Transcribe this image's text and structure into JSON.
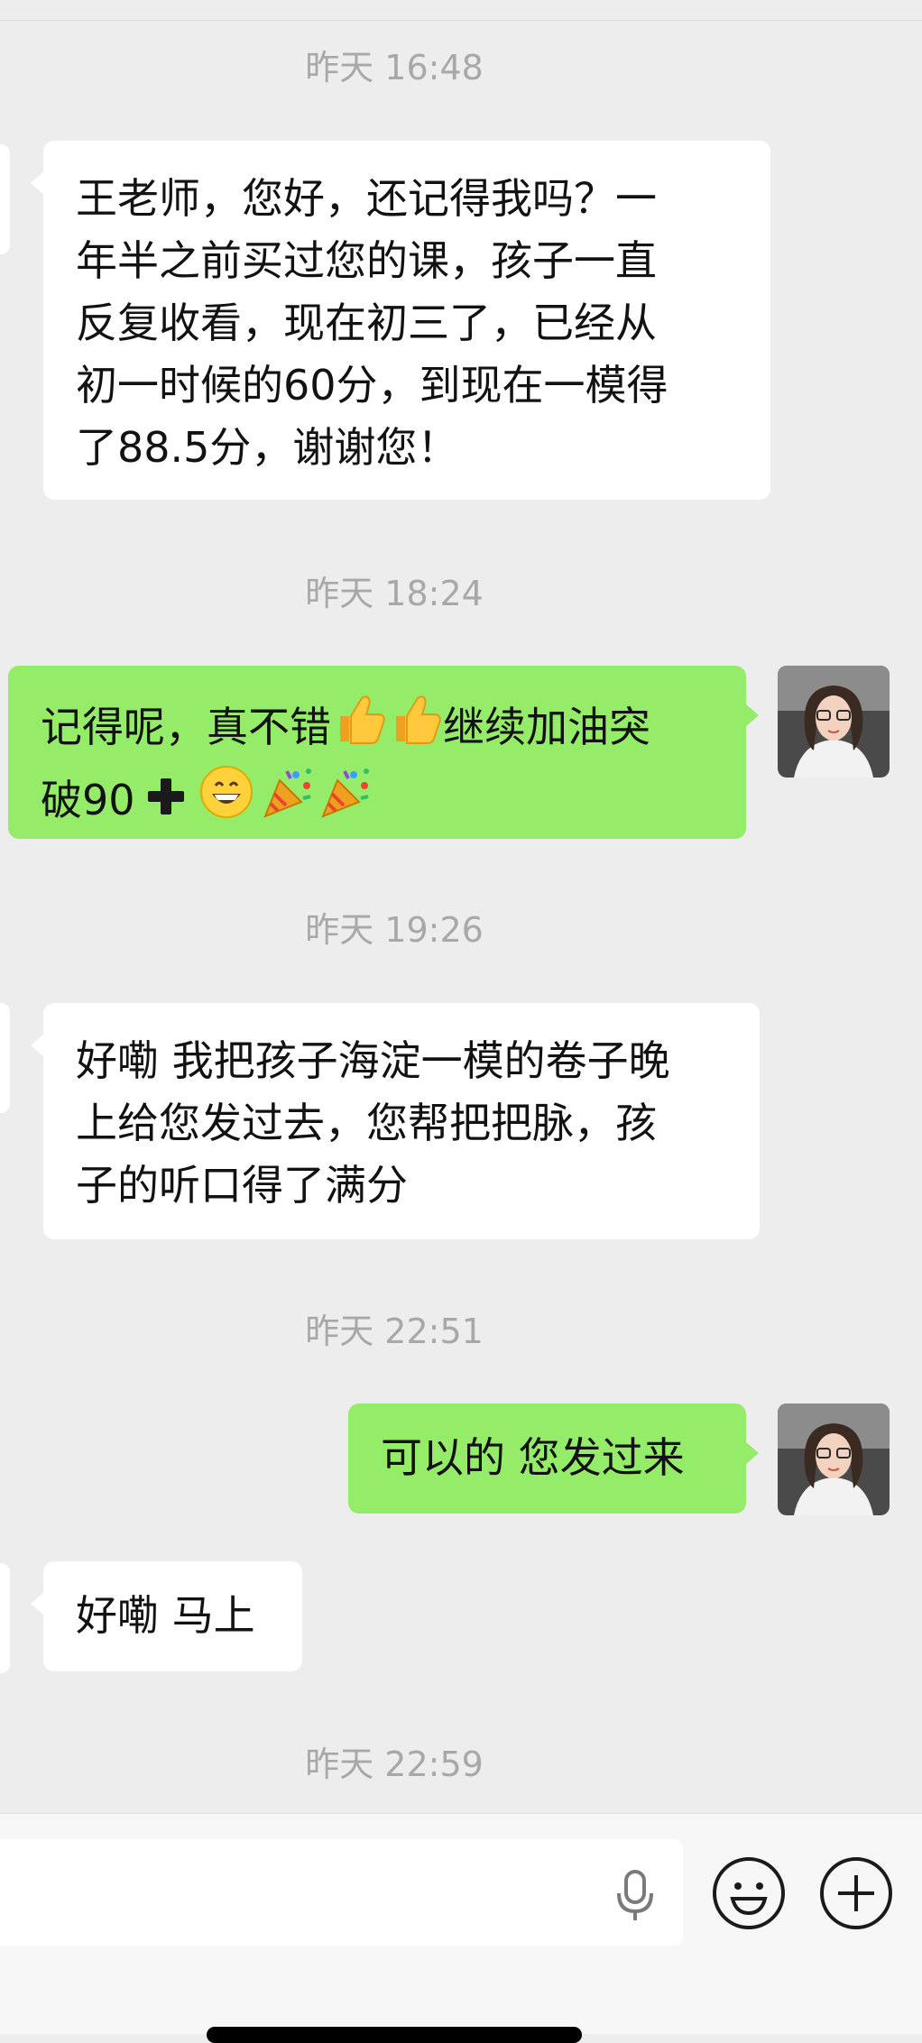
{
  "timestamps": {
    "t1": "昨天 16:48",
    "t2": "昨天 18:24",
    "t3": "昨天 19:26",
    "t4": "昨天 22:51",
    "t5": "昨天 22:59"
  },
  "messages": {
    "m1": {
      "sender": "other",
      "lines": [
        "王老师，您好，还记得我吗？一",
        "年半之前买过您的课，孩子一直",
        "反复收看，现在初三了，已经从",
        "初一时候的60分，到现在一模得",
        "了88.5分，谢谢您！"
      ]
    },
    "m2": {
      "sender": "me",
      "line1_text": "记得呢，真不错",
      "line1_text_after": "继续加油突",
      "line2_text": "破90",
      "emojis": [
        "thumbs-up",
        "thumbs-up",
        "heavy-plus",
        "grinning-face",
        "party-popper",
        "party-popper"
      ]
    },
    "m3": {
      "sender": "other",
      "lines": [
        "好嘞 我把孩子海淀一模的卷子晚",
        "上给您发过去，您帮把把脉，孩",
        "子的听口得了满分"
      ]
    },
    "m4": {
      "sender": "me",
      "text": "可以的 您发过来"
    },
    "m5": {
      "sender": "other",
      "text": "好嘞 马上"
    }
  },
  "input_bar": {
    "icons": [
      "microphone-icon",
      "emoji-face-icon",
      "plus-icon"
    ]
  },
  "colors": {
    "background": "#ededed",
    "incoming_bubble": "#ffffff",
    "outgoing_bubble": "#95ec69",
    "timestamp": "#a8a8a8"
  }
}
